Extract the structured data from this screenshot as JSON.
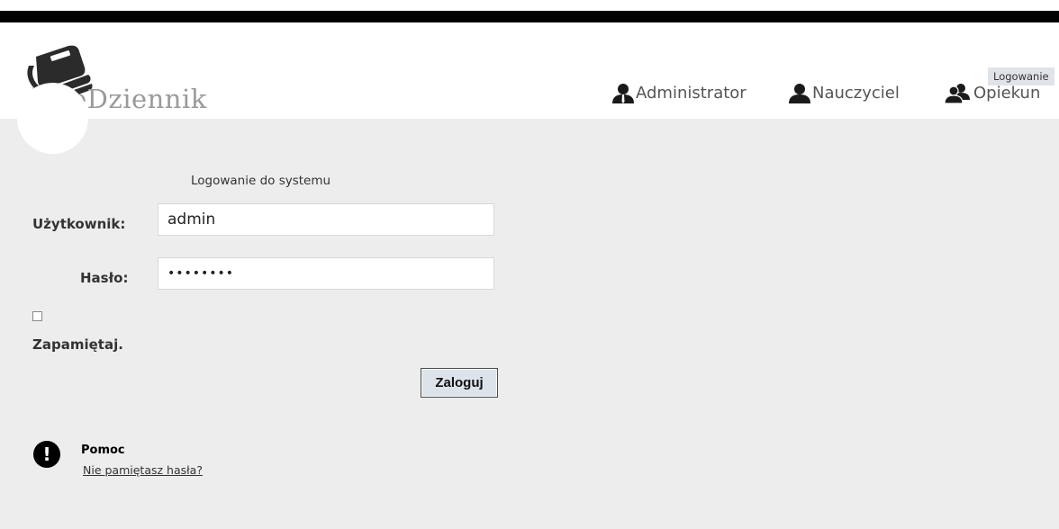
{
  "header": {
    "logo_text": "eDziennik",
    "login_link": "Logowanie",
    "nav": [
      {
        "label": "Administrator",
        "icon": "admin-user-icon"
      },
      {
        "label": "Nauczyciel",
        "icon": "teacher-user-icon"
      },
      {
        "label": "Opiekun",
        "icon": "guardian-users-icon"
      }
    ]
  },
  "login_form": {
    "title": "Logowanie do systemu",
    "username_label": "Użytkownik:",
    "username_value": "admin",
    "password_label": "Hasło:",
    "password_value": "••••••••",
    "remember_label": "Zapamiętaj.",
    "remember_checked": false,
    "submit_label": "Zaloguj"
  },
  "help": {
    "icon": "exclamation-icon",
    "title": "Pomoc",
    "link": "Nie pamiętasz hasła?"
  },
  "colors": {
    "background": "#ededed",
    "header_bar": "#000000",
    "logo_text": "#9a9a9a"
  }
}
